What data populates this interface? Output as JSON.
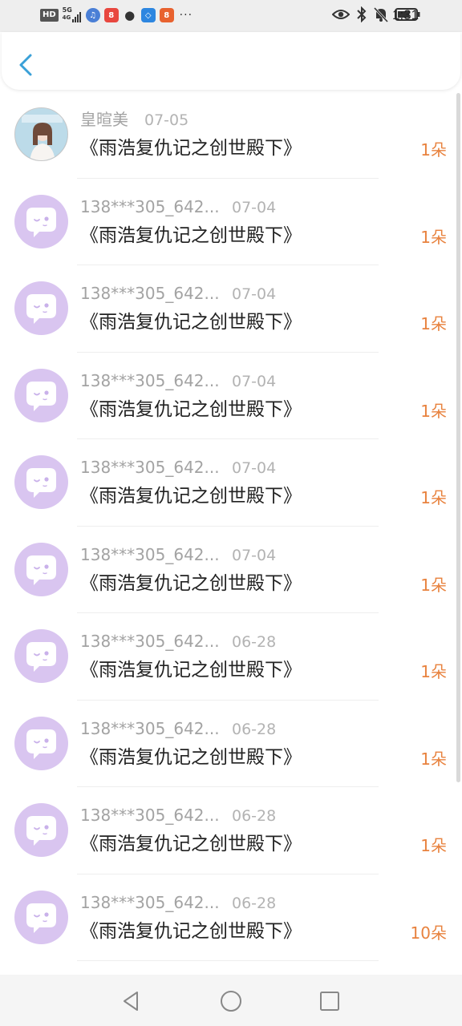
{
  "status_bar": {
    "hd": "HD",
    "net_top": "5G",
    "net_bottom": "4G",
    "time": "1:31",
    "left_icons": [
      "hd-badge",
      "signal-icon",
      "music-app-icon",
      "video-app-icon",
      "wechat-icon",
      "browser-app-icon",
      "reader-app-icon"
    ],
    "overflow": "···",
    "right_icons": [
      "eye-icon",
      "bluetooth-icon",
      "mute-icon",
      "battery-icon"
    ]
  },
  "header": {
    "back_icon": "chevron-left-icon"
  },
  "list": {
    "items": [
      {
        "name": "皇暄美",
        "date": "07-05",
        "book": "《雨浩复仇记之创世殿下》",
        "amount": "1朵",
        "avatar": "photo"
      },
      {
        "name": "138***305_642...",
        "date": "07-04",
        "book": "《雨浩复仇记之创世殿下》",
        "amount": "1朵",
        "avatar": "default"
      },
      {
        "name": "138***305_642...",
        "date": "07-04",
        "book": "《雨浩复仇记之创世殿下》",
        "amount": "1朵",
        "avatar": "default"
      },
      {
        "name": "138***305_642...",
        "date": "07-04",
        "book": "《雨浩复仇记之创世殿下》",
        "amount": "1朵",
        "avatar": "default"
      },
      {
        "name": "138***305_642...",
        "date": "07-04",
        "book": "《雨浩复仇记之创世殿下》",
        "amount": "1朵",
        "avatar": "default"
      },
      {
        "name": "138***305_642...",
        "date": "07-04",
        "book": "《雨浩复仇记之创世殿下》",
        "amount": "1朵",
        "avatar": "default"
      },
      {
        "name": "138***305_642...",
        "date": "06-28",
        "book": "《雨浩复仇记之创世殿下》",
        "amount": "1朵",
        "avatar": "default"
      },
      {
        "name": "138***305_642...",
        "date": "06-28",
        "book": "《雨浩复仇记之创世殿下》",
        "amount": "1朵",
        "avatar": "default"
      },
      {
        "name": "138***305_642...",
        "date": "06-28",
        "book": "《雨浩复仇记之创世殿下》",
        "amount": "1朵",
        "avatar": "default"
      },
      {
        "name": "138***305_642...",
        "date": "06-28",
        "book": "《雨浩复仇记之创世殿下》",
        "amount": "10朵",
        "avatar": "default"
      }
    ]
  },
  "nav_bar": {
    "icons": [
      "nav-back-icon",
      "nav-home-icon",
      "nav-recents-icon"
    ]
  },
  "colors": {
    "accent": "#3aa0d8",
    "amount": "#e8823e",
    "avatar_bg": "#d9c5f0",
    "avatar_bubble": "#ffffff",
    "muted_text": "#a3a3a3",
    "title_text": "#222222"
  }
}
